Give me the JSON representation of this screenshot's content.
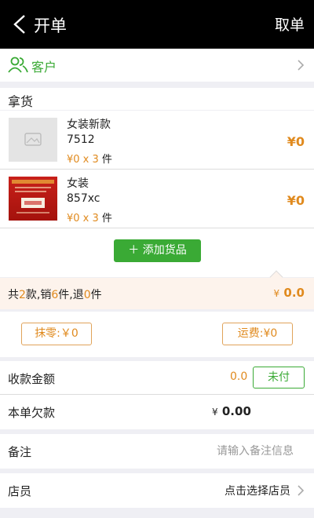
{
  "header": {
    "title": "开单",
    "right_action": "取单"
  },
  "customer": {
    "label": "客户"
  },
  "goods_section": {
    "title": "拿货"
  },
  "items": [
    {
      "name": "女装新款",
      "code": "7512",
      "qty_text": "¥0 x 3",
      "unit": "件",
      "total": "¥0"
    },
    {
      "name": "女装",
      "code": "857xc",
      "qty_text": "¥0 x 3",
      "unit": "件",
      "total": "¥0"
    }
  ],
  "add_button": {
    "label": "添加货品"
  },
  "summary": {
    "prefix": "共",
    "styles_count": "2",
    "styles_suffix": "款,销",
    "sold_count": "6",
    "sold_suffix": "件,退",
    "returned_count": "0",
    "returned_suffix": "件",
    "currency": "¥",
    "total": "0.0"
  },
  "adjustments": {
    "rounding": "抹零:￥0",
    "shipping": "运费:¥0"
  },
  "payment": {
    "label": "收款金额",
    "amount": "0.0",
    "status_button": "未付"
  },
  "owed": {
    "label": "本单欠款",
    "currency": "¥",
    "amount": "0.00"
  },
  "note": {
    "label": "备注",
    "placeholder": "请输入备注信息"
  },
  "staff": {
    "label": "店员",
    "value": "点击选择店员"
  },
  "colors": {
    "accent_green": "#3aaa35",
    "accent_orange": "#e08a1e",
    "header_bg": "#000000"
  }
}
